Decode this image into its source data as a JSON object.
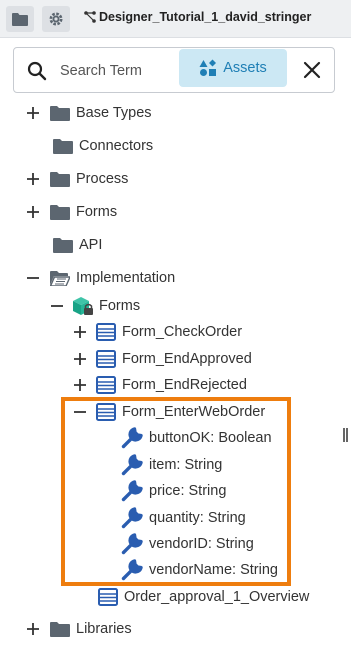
{
  "toolbar": {
    "project_title": "Designer_Tutorial_1_david_stringer"
  },
  "search": {
    "placeholder": "Search Term",
    "assets_label": "Assets"
  },
  "tree": {
    "base_types": "Base Types",
    "connectors": "Connectors",
    "process": "Process",
    "forms": "Forms",
    "api": "API",
    "implementation": "Implementation",
    "impl_forms": "Forms",
    "form_check_order": "Form_CheckOrder",
    "form_end_approved": "Form_EndApproved",
    "form_end_rejected": "Form_EndRejected",
    "form_enter_web_order": "Form_EnterWebOrder",
    "fields": [
      {
        "name": "buttonOK",
        "type": "Boolean"
      },
      {
        "name": "item",
        "type": "String"
      },
      {
        "name": "price",
        "type": "String"
      },
      {
        "name": "quantity",
        "type": "String"
      },
      {
        "name": "vendorID",
        "type": "String"
      },
      {
        "name": "vendorName",
        "type": "String"
      }
    ],
    "order_overview": "Order_approval_1_Overview",
    "libraries": "Libraries"
  },
  "colors": {
    "accent": "#1f7fb5",
    "form_icon": "#2a5db0",
    "wrench_icon": "#2a5db0",
    "highlight_border": "#ee7d0e",
    "folder": "#5c6670"
  }
}
